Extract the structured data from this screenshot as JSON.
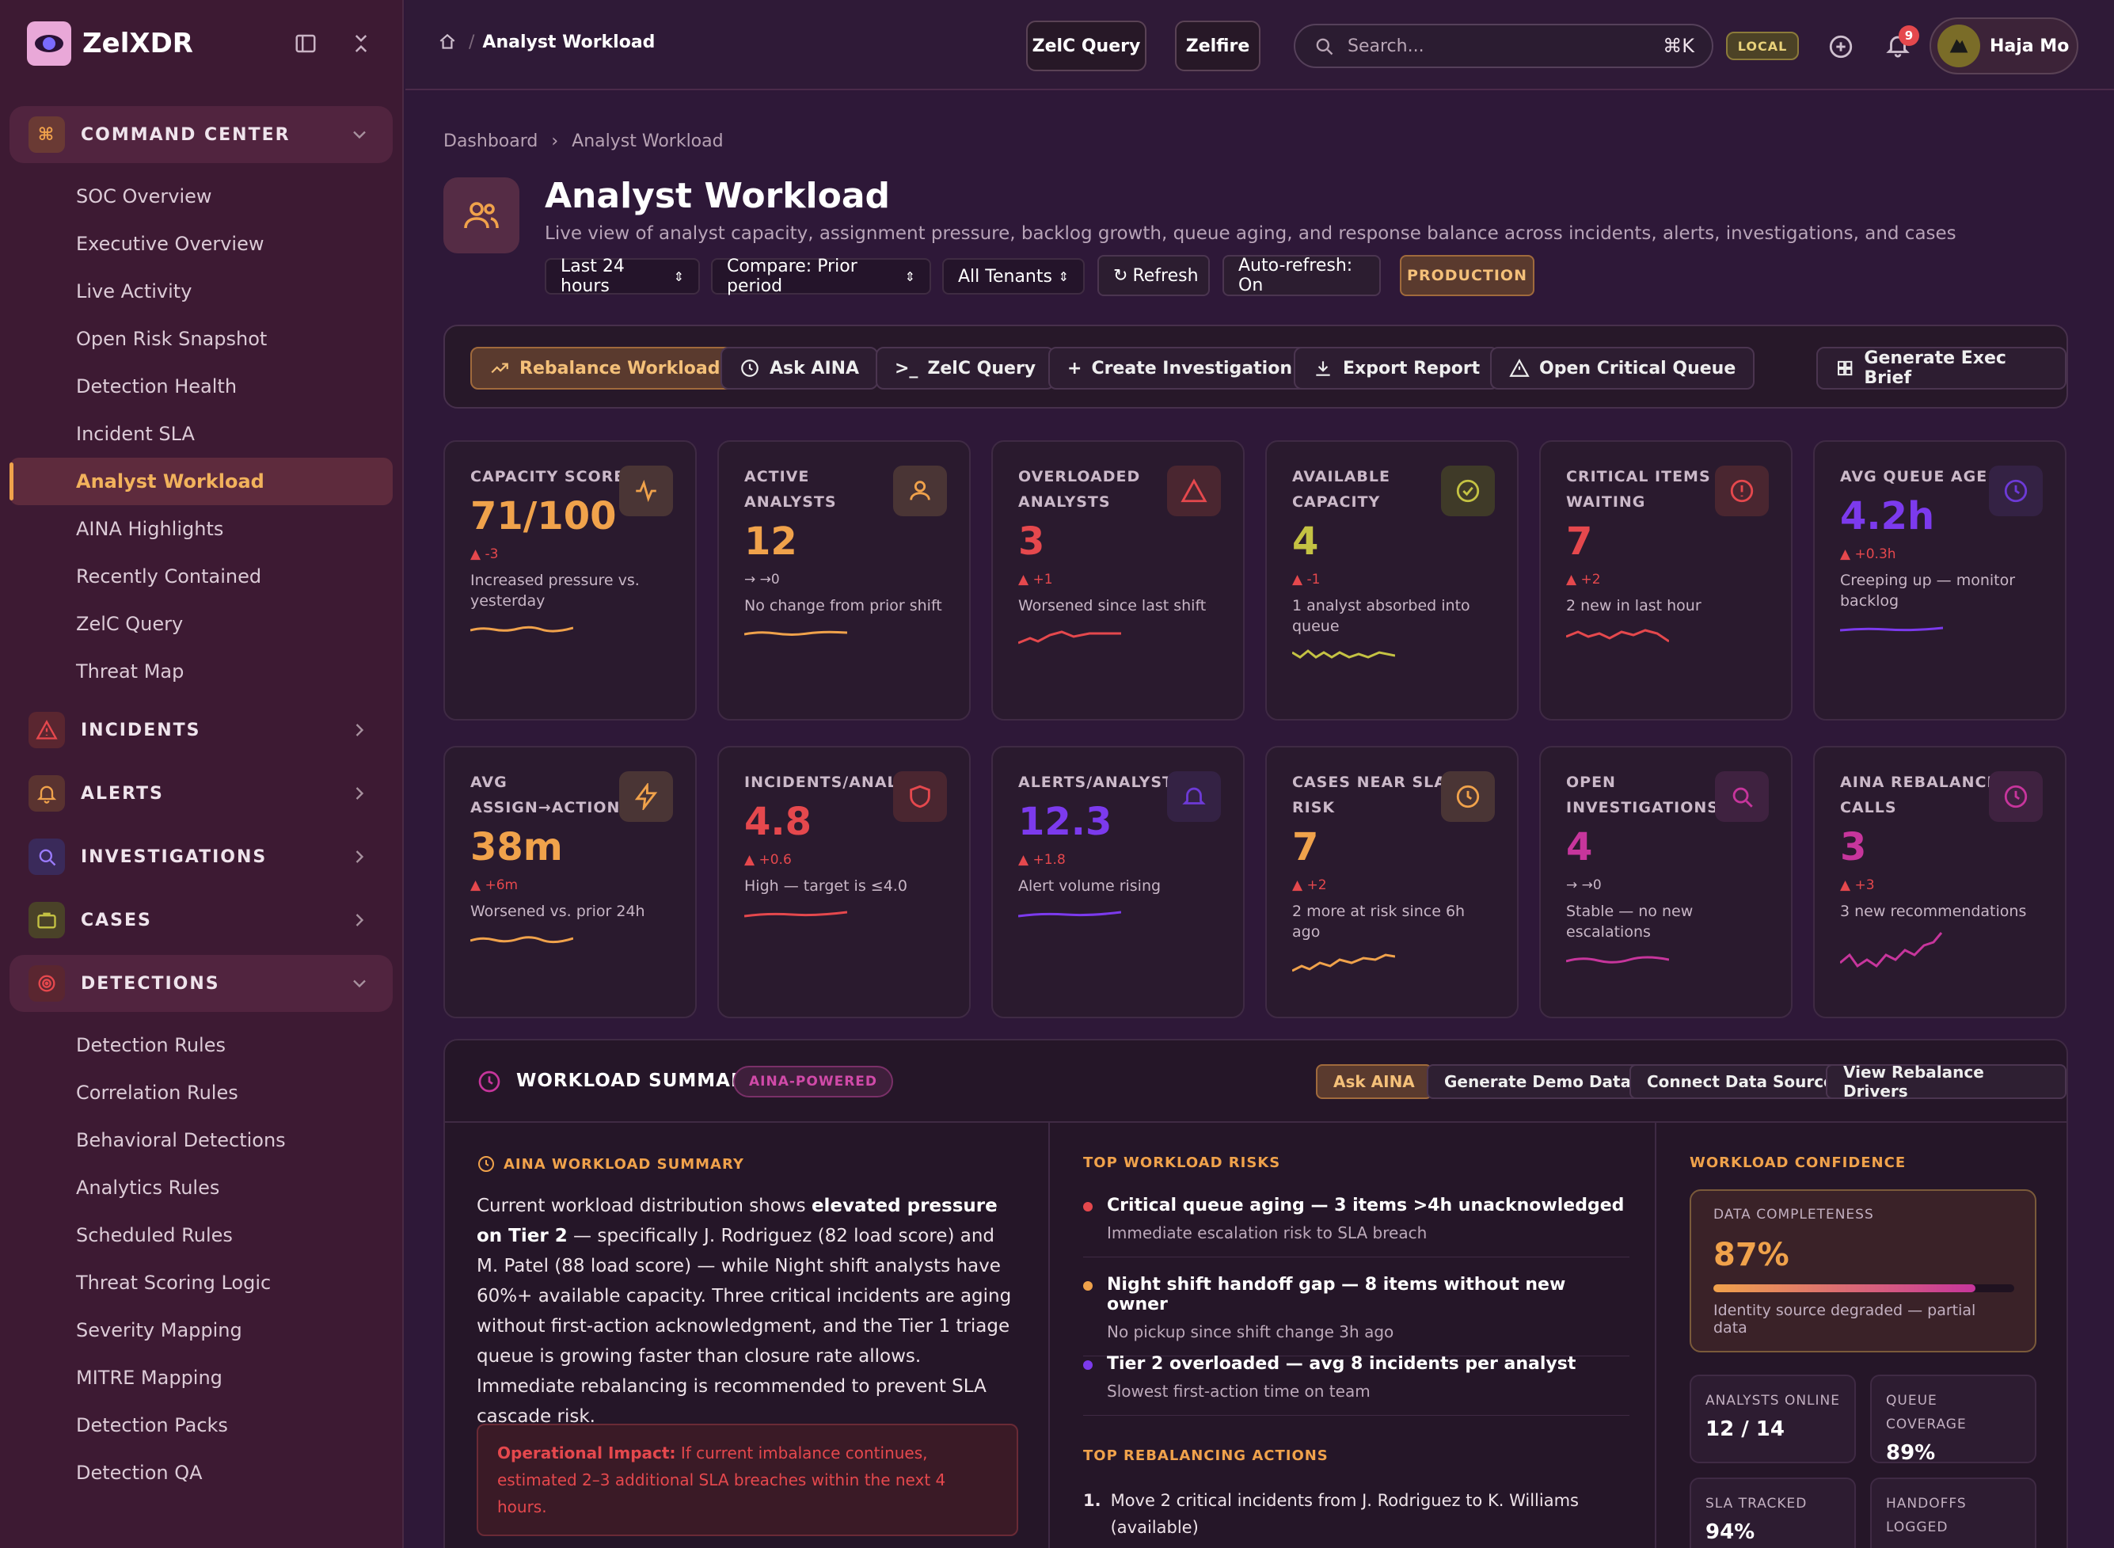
{
  "sidebar": {
    "brand": "ZelXDR",
    "command_center": "COMMAND CENTER",
    "command_items": [
      "SOC Overview",
      "Executive Overview",
      "Live Activity",
      "Open Risk Snapshot",
      "Detection Health",
      "Incident SLA",
      "Analyst Workload",
      "AINA Highlights",
      "Recently Contained",
      "ZelC Query",
      "Threat Map"
    ],
    "incidents": "INCIDENTS",
    "alerts": "ALERTS",
    "investigations": "INVESTIGATIONS",
    "cases": "CASES",
    "detections": "DETECTIONS",
    "detection_items": [
      "Detection Rules",
      "Correlation Rules",
      "Behavioral Detections",
      "Analytics Rules",
      "Scheduled Rules",
      "Threat Scoring Logic",
      "Severity Mapping",
      "MITRE Mapping",
      "Detection Packs",
      "Detection QA"
    ]
  },
  "topbar": {
    "crumb": "Analyst Workload",
    "zelc_query": "ZelC Query",
    "zelfire": "Zelfire",
    "search_placeholder": "Search...",
    "shortcut": "⌘K",
    "env": "LOCAL",
    "notif_count": "9",
    "user": "Haja Mo"
  },
  "page": {
    "crumb_root": "Dashboard",
    "crumb_current": "Analyst Workload",
    "title": "Analyst Workload",
    "subtitle": "Live view of analyst capacity, assignment pressure, backlog growth, queue aging, and response balance across incidents, alerts, investigations, and cases",
    "range": "Last 24 hours",
    "compare": "Compare: Prior period",
    "tenants": "All Tenants",
    "refresh": "Refresh",
    "autorefresh": "Auto-refresh: On",
    "badge": "PRODUCTION"
  },
  "actions": {
    "rebalance": "Rebalance Workload",
    "ask": "Ask AINA",
    "query": "ZelC Query",
    "create": "Create Investigation",
    "export": "Export Report",
    "critical": "Open Critical Queue",
    "brief": "Generate Exec Brief"
  },
  "cards": [
    {
      "label": "CAPACITY SCORE",
      "value": "71/100",
      "delta": "▲ -3",
      "desc": "Increased pressure vs. yesterday"
    },
    {
      "label": "ACTIVE ANALYSTS",
      "value": "12",
      "delta": "→ →0",
      "desc": "No change from prior shift"
    },
    {
      "label": "OVERLOADED ANALYSTS",
      "value": "3",
      "delta": "▲ +1",
      "desc": "Worsened since last shift"
    },
    {
      "label": "AVAILABLE CAPACITY",
      "value": "4",
      "delta": "▲ -1",
      "desc": "1 analyst absorbed into queue"
    },
    {
      "label": "CRITICAL ITEMS WAITING",
      "value": "7",
      "delta": "▲ +2",
      "desc": "2 new in last hour"
    },
    {
      "label": "AVG QUEUE AGE",
      "value": "4.2h",
      "delta": "▲ +0.3h",
      "desc": "Creeping up — monitor backlog"
    },
    {
      "label": "AVG ASSIGN→ACTION",
      "value": "38m",
      "delta": "▲ +6m",
      "desc": "Worsened vs. prior 24h"
    },
    {
      "label": "INCIDENTS/ANALYST",
      "value": "4.8",
      "delta": "▲ +0.6",
      "desc": "High — target is ≤4.0"
    },
    {
      "label": "ALERTS/ANALYST",
      "value": "12.3",
      "delta": "▲ +1.8",
      "desc": "Alert volume rising"
    },
    {
      "label": "CASES NEAR SLA RISK",
      "value": "7",
      "delta": "▲ +2",
      "desc": "2 more at risk since 6h ago"
    },
    {
      "label": "OPEN INVESTIGATIONS",
      "value": "4",
      "delta": "→ →0",
      "desc": "Stable — no new escalations"
    },
    {
      "label": "AINA REBALANCE CALLS",
      "value": "3",
      "delta": "▲ +3",
      "desc": "3 new recommendations"
    }
  ],
  "summary": {
    "title": "WORKLOAD SUMMARY",
    "badge": "AINA-POWERED",
    "ask": "Ask AINA",
    "demo": "Generate Demo Data",
    "connect": "Connect Data Source",
    "drivers": "View Rebalance Drivers",
    "aina_label": "AINA WORKLOAD SUMMARY",
    "text_a": "Current workload distribution shows ",
    "text_bold": "elevated pressure on Tier 2",
    "text_b": " — specifically J. Rodriguez (82 load score) and M. Patel (88 load score) — while Night shift analysts have 60%+ available capacity. Three critical incidents are aging without first-action acknowledgment, and the Tier 1 triage queue is growing faster than closure rate allows. Immediate rebalancing is recommended to prevent SLA cascade risk.",
    "impact_label": "Operational Impact:",
    "impact_text": " If current imbalance continues, estimated 2–3 additional SLA breaches within the next 4 hours.",
    "risks_label": "TOP WORKLOAD RISKS",
    "risks": [
      {
        "title": "Critical queue aging — 3 items >4h unacknowledged",
        "sub": "Immediate escalation risk to SLA breach"
      },
      {
        "title": "Night shift handoff gap — 8 items without new owner",
        "sub": "No pickup since shift change 3h ago"
      },
      {
        "title": "Tier 2 overloaded — avg 8 incidents per analyst",
        "sub": "Slowest first-action time on team"
      }
    ],
    "actions_label": "TOP REBALANCING ACTIONS",
    "action1": "Move 2 critical incidents from J. Rodriguez to K. Williams (available)",
    "action1_num": "1.",
    "conf_label": "WORKLOAD CONFIDENCE",
    "completeness_label": "DATA COMPLETENESS",
    "completeness": "87%",
    "completeness_note": "Identity source degraded — partial data",
    "online_label": "ANALYSTS ONLINE",
    "online": "12 / 14",
    "coverage_label": "QUEUE COVERAGE",
    "coverage": "89%",
    "sla_label": "SLA TRACKED",
    "sla": "94%",
    "handoffs_label": "HANDOFFS LOGGED"
  },
  "colors": {
    "accent": "#f0a24b",
    "red": "#e5484d",
    "purple": "#7c3aed",
    "olive": "#c4c243",
    "magenta": "#c7359c"
  }
}
